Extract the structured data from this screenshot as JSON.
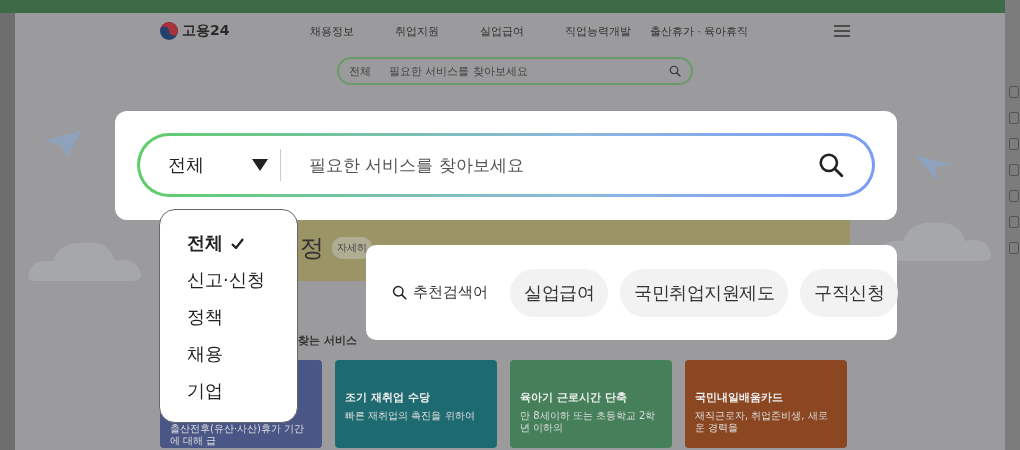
{
  "background_page": {
    "logo": "고용24",
    "nav": [
      "채용정보",
      "취업지원",
      "실업급여",
      "직업능력개발",
      "출산휴가 · 육아휴직"
    ],
    "search": {
      "category": "전체",
      "placeholder": "필요한 서비스를 찾아보세요"
    },
    "banner": {
      "heading": "정",
      "button": "자세히"
    },
    "section_title": "찾는 서비스",
    "cards": [
      {
        "description": "출산전후(유산·사산)휴가 기간에 대해 급",
        "color": "#4a5686"
      },
      {
        "title": "조기 재취업 수당",
        "description": "빠른 재취업의 촉진을 위하여",
        "color": "#1d6a70"
      },
      {
        "title": "육아기 근로시간 단축",
        "description": "만 8세이하 또는 초등학교 2학년 이하의",
        "color": "#46805a"
      },
      {
        "title": "국민내일배움카드",
        "description": "재직근로자, 취업준비생, 새로운 경력을",
        "color": "#8a4722"
      }
    ]
  },
  "search_modal": {
    "category": "전체",
    "placeholder": "필요한 서비스를 찾아보세요"
  },
  "category_menu": [
    {
      "label": "전체",
      "selected": true
    },
    {
      "label": "신고·신청",
      "selected": false
    },
    {
      "label": "정책",
      "selected": false
    },
    {
      "label": "채용",
      "selected": false
    },
    {
      "label": "기업",
      "selected": false
    }
  ],
  "recommended": {
    "label": "추천검색어",
    "keywords": [
      "실업급여",
      "국민취업지원제도",
      "구직신청"
    ]
  }
}
